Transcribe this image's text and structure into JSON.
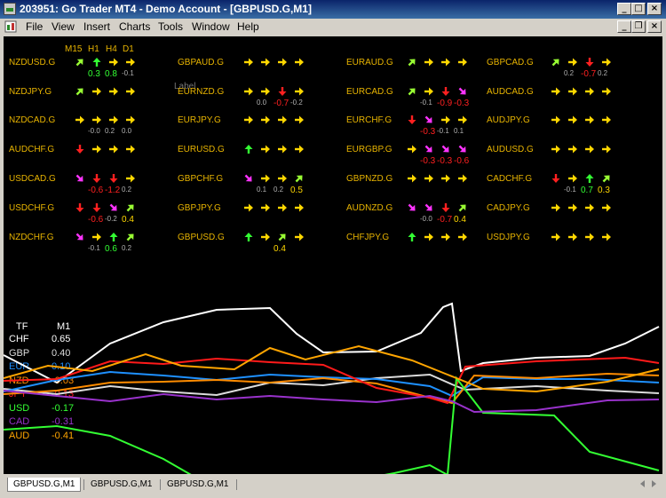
{
  "window": {
    "title": "203951: Go Trader MT4 - Demo Account - [GBPUSD.G,M1]"
  },
  "menu": [
    "File",
    "View",
    "Insert",
    "Charts",
    "Tools",
    "Window",
    "Help"
  ],
  "matrix": {
    "headers": [
      "M15",
      "H1",
      "H4",
      "D1"
    ],
    "ghost_label": "Label",
    "colors": {
      "strong_up": "#33ff33",
      "up": "#99ff33",
      "flat": "#ffd700",
      "down": "#ff2020",
      "weak_down": "#ff33ff"
    },
    "symbols": [
      {
        "name": "NZDUSD.G",
        "arrows": [
          "up",
          "strong_up",
          "flat",
          "flat"
        ],
        "values": [
          "0.3",
          "0.8",
          "-0.1"
        ]
      },
      {
        "name": "NZDJPY.G",
        "arrows": [
          "up",
          "flat",
          "flat",
          "flat"
        ],
        "values": []
      },
      {
        "name": "NZDCAD.G",
        "arrows": [
          "flat",
          "flat",
          "flat",
          "flat"
        ],
        "values": [
          "-0.0",
          "0.2",
          "0.0"
        ]
      },
      {
        "name": "AUDCHF.G",
        "arrows": [
          "down",
          "flat",
          "flat",
          "flat"
        ],
        "values": []
      },
      {
        "name": "USDCAD.G",
        "arrows": [
          "weak_down",
          "down",
          "down",
          "flat"
        ],
        "values": [
          "-0.6",
          "-1.2",
          "0.2"
        ]
      },
      {
        "name": "USDCHF.G",
        "arrows": [
          "down",
          "down",
          "weak_down",
          "up"
        ],
        "values": [
          "-0.6",
          "-0.2",
          "0.4"
        ]
      },
      {
        "name": "NZDCHF.G",
        "arrows": [
          "weak_down",
          "flat",
          "strong_up",
          "up"
        ],
        "values": [
          "-0.1",
          "0.6",
          "0.2"
        ]
      },
      {
        "name": "GBPAUD.G",
        "arrows": [
          "flat",
          "flat",
          "flat",
          "flat"
        ],
        "values": []
      },
      {
        "name": "EURNZD.G",
        "arrows": [
          "flat",
          "flat",
          "down",
          "flat"
        ],
        "values": [
          "0.0",
          "-0.7",
          "-0.2"
        ]
      },
      {
        "name": "EURJPY.G",
        "arrows": [
          "flat",
          "flat",
          "flat",
          "flat"
        ],
        "values": []
      },
      {
        "name": "EURUSD.G",
        "arrows": [
          "strong_up",
          "flat",
          "flat",
          "flat"
        ],
        "values": []
      },
      {
        "name": "GBPCHF.G",
        "arrows": [
          "weak_down",
          "flat",
          "flat",
          "up"
        ],
        "values": [
          "0.1",
          "0.2",
          "0.5"
        ]
      },
      {
        "name": "GBPJPY.G",
        "arrows": [
          "flat",
          "flat",
          "flat",
          "flat"
        ],
        "values": []
      },
      {
        "name": "GBPUSD.G",
        "arrows": [
          "strong_up",
          "flat",
          "up",
          "flat"
        ],
        "values": [
          "0.4"
        ]
      },
      {
        "name": "EURAUD.G",
        "arrows": [
          "up",
          "flat",
          "flat",
          "flat"
        ],
        "values": []
      },
      {
        "name": "EURCAD.G",
        "arrows": [
          "up",
          "flat",
          "down",
          "weak_down"
        ],
        "values": [
          "-0.1",
          "-0.9",
          "-0.3"
        ]
      },
      {
        "name": "EURCHF.G",
        "arrows": [
          "down",
          "weak_down",
          "flat",
          "flat"
        ],
        "values": [
          "-0.3",
          "-0.1",
          "0.1"
        ]
      },
      {
        "name": "EURGBP.G",
        "arrows": [
          "flat",
          "weak_down",
          "weak_down",
          "weak_down"
        ],
        "values": [
          "-0.3",
          "-0.3",
          "-0.6"
        ]
      },
      {
        "name": "GBPNZD.G",
        "arrows": [
          "flat",
          "flat",
          "flat",
          "flat"
        ],
        "values": []
      },
      {
        "name": "AUDNZD.G",
        "arrows": [
          "weak_down",
          "weak_down",
          "down",
          "up"
        ],
        "values": [
          "-0.0",
          "-0.7",
          "0.4"
        ]
      },
      {
        "name": "CHFJPY.G",
        "arrows": [
          "strong_up",
          "flat",
          "flat",
          "flat"
        ],
        "values": []
      },
      {
        "name": "GBPCAD.G",
        "arrows": [
          "up",
          "flat",
          "down",
          "flat"
        ],
        "values": [
          "0.2",
          "-0.7",
          "0.2"
        ]
      },
      {
        "name": "AUDCAD.G",
        "arrows": [
          "flat",
          "flat",
          "flat",
          "flat"
        ],
        "values": []
      },
      {
        "name": "AUDJPY.G",
        "arrows": [
          "flat",
          "flat",
          "flat",
          "flat"
        ],
        "values": []
      },
      {
        "name": "AUDUSD.G",
        "arrows": [
          "flat",
          "flat",
          "flat",
          "flat"
        ],
        "values": []
      },
      {
        "name": "CADCHF.G",
        "arrows": [
          "down",
          "flat",
          "strong_up",
          "up"
        ],
        "values": [
          "-0.1",
          "0.7",
          "0.3"
        ]
      },
      {
        "name": "CADJPY.G",
        "arrows": [
          "flat",
          "flat",
          "flat",
          "flat"
        ],
        "values": []
      },
      {
        "name": "USDJPY.G",
        "arrows": [
          "flat",
          "flat",
          "flat",
          "flat"
        ],
        "values": []
      }
    ]
  },
  "currency_panel": {
    "header": [
      "TF",
      "M1"
    ],
    "rows": [
      {
        "cur": "CHF",
        "val": "0.65",
        "color": "#ffffff"
      },
      {
        "cur": "GBP",
        "val": "0.40",
        "color": "#dcdcdc"
      },
      {
        "cur": "EUR",
        "val": "0.10",
        "color": "#1e90ff"
      },
      {
        "cur": "NZD",
        "val": "-0.03",
        "color": "#ff8c00"
      },
      {
        "cur": "JPY",
        "val": "-0.13",
        "color": "#ff1a1a"
      },
      {
        "cur": "USD",
        "val": "-0.17",
        "color": "#33ff33"
      },
      {
        "cur": "CAD",
        "val": "-0.31",
        "color": "#9932cc"
      },
      {
        "cur": "AUD",
        "val": "-0.41",
        "color": "#ffa500"
      }
    ]
  },
  "tabs": [
    "GBPUSD.G,M1",
    "GBPUSD.G,M1",
    "GBPUSD.G,M1"
  ]
}
